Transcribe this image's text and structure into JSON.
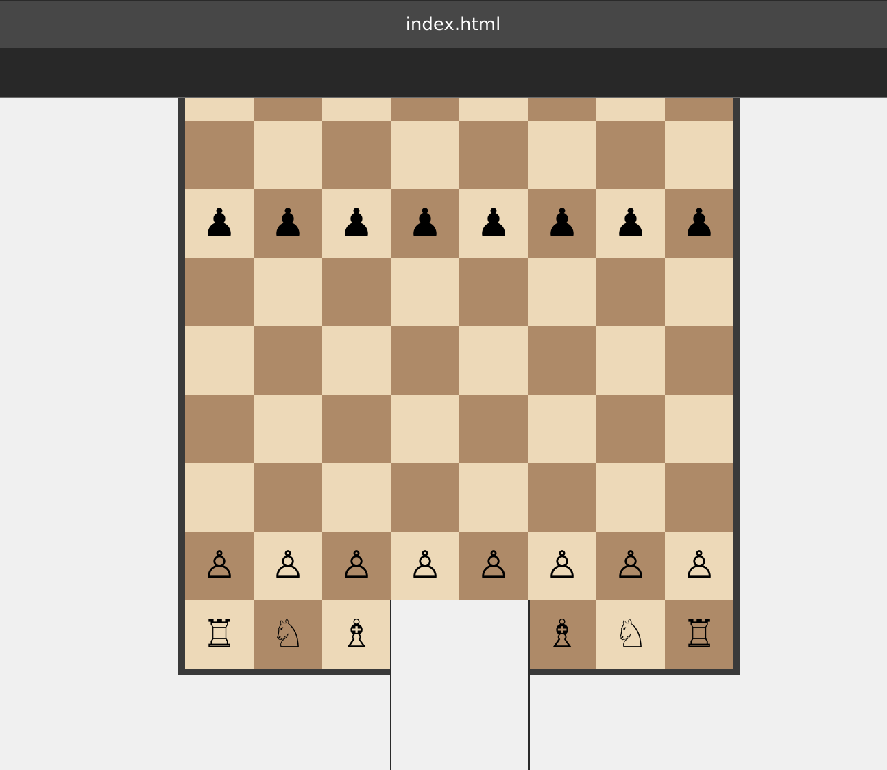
{
  "window": {
    "title": "index.html"
  },
  "colors": {
    "light_square": "#edd9b8",
    "dark_square": "#ae8a68",
    "board_border": "#3a3a3a"
  },
  "board": {
    "visible_ranks_from_top": [
      [
        "",
        "",
        "",
        "",
        "",
        "",
        "",
        ""
      ],
      [
        "♟",
        "♟",
        "♟",
        "♟",
        "♟",
        "♟",
        "♟",
        "♟"
      ],
      [
        "",
        "",
        "",
        "",
        "",
        "",
        "",
        ""
      ],
      [
        "",
        "",
        "",
        "",
        "",
        "",
        "",
        ""
      ],
      [
        "",
        "",
        "",
        "",
        "",
        "",
        "",
        ""
      ],
      [
        "",
        "",
        "",
        "",
        "",
        "",
        "",
        ""
      ],
      [
        "♙",
        "♙",
        "♙",
        "♙",
        "♙",
        "♙",
        "♙",
        "♙"
      ],
      [
        "♖",
        "♘",
        "♗",
        "♕",
        "♔",
        "♗",
        "♘",
        "♖"
      ]
    ]
  }
}
